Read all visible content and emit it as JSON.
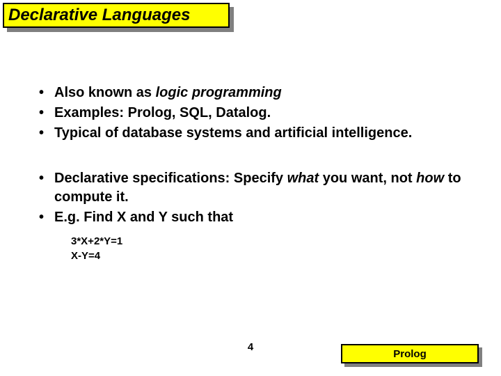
{
  "title": "Declarative Languages",
  "bullets_group1": [
    {
      "pre": "Also known as ",
      "em": "logic programming",
      "post": ""
    },
    {
      "pre": "Examples: Prolog, SQL, Datalog.",
      "em": "",
      "post": ""
    },
    {
      "pre": "Typical of database systems and artificial intelligence.",
      "em": "",
      "post": ""
    }
  ],
  "bullets_group2": [
    {
      "pre": "Declarative specifications:  Specify ",
      "em": "what",
      "post": " you want, not ",
      "em2": "how",
      "post2": " to compute it."
    },
    {
      "pre": "E.g. Find X and Y such that",
      "em": "",
      "post": ""
    }
  ],
  "equations": [
    "3*X+2*Y=1",
    "X-Y=4"
  ],
  "page_number": "4",
  "footer_label": "Prolog"
}
